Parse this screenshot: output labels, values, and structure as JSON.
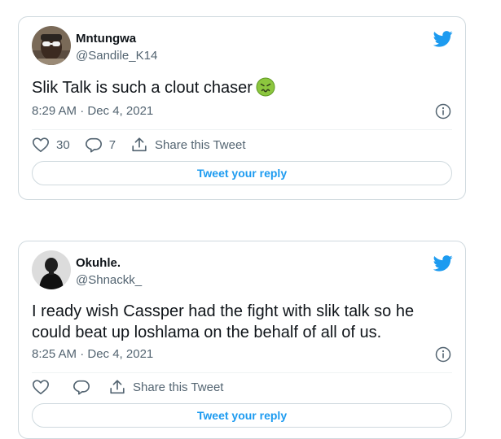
{
  "colors": {
    "brand_blue": "#1d9bf0",
    "text_primary": "#0f1419",
    "text_secondary": "#536471",
    "border": "#cfd9de"
  },
  "tweets": [
    {
      "author_name": "Mntungwa",
      "author_handle": "@Sandile_K14",
      "text": "Slik Talk is such a clout chaser",
      "emoji": "nauseated-face-emoji",
      "timestamp": "8:29 AM · Dec 4, 2021",
      "like_count": "30",
      "reply_count": "7",
      "share_label": "Share this Tweet",
      "reply_button_label": "Tweet your reply"
    },
    {
      "author_name": "Okuhle.",
      "author_handle": "@Shnackk_",
      "text": "I ready wish Cassper had the fight with slik talk so he could beat up loshlama on the behalf of all of us.",
      "timestamp": "8:25 AM · Dec 4, 2021",
      "like_count": "",
      "reply_count": "",
      "share_label": "Share this Tweet",
      "reply_button_label": "Tweet your reply"
    }
  ],
  "icons": [
    "twitter-bird-icon",
    "info-icon",
    "heart-icon",
    "reply-icon",
    "share-icon"
  ]
}
